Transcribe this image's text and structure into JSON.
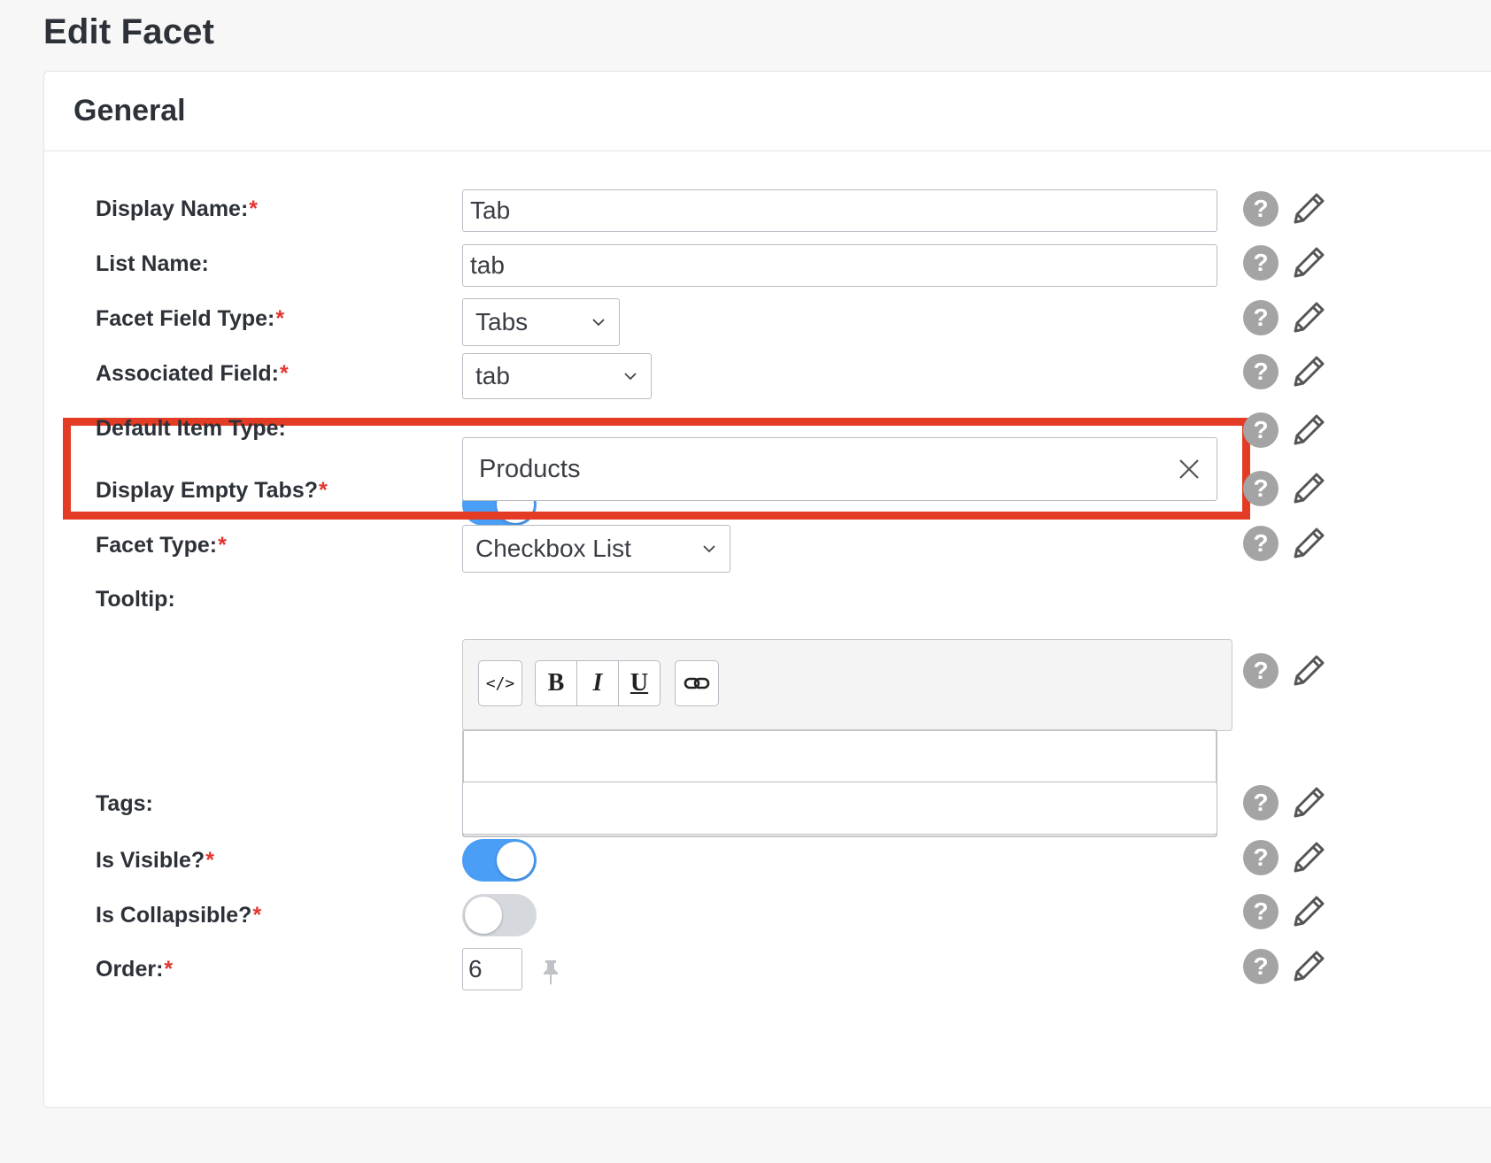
{
  "page": {
    "title": "Edit Facet"
  },
  "section": {
    "title": "General"
  },
  "required_mark": "*",
  "help_symbol": "?",
  "fields": {
    "display_name": {
      "label": "Display Name:",
      "value": "Tab",
      "required": true
    },
    "list_name": {
      "label": "List Name:",
      "value": "tab",
      "required": false
    },
    "facet_field_type": {
      "label": "Facet Field Type:",
      "value": "Tabs",
      "required": true
    },
    "associated_field": {
      "label": "Associated Field:",
      "value": "tab",
      "required": true
    },
    "default_item_type": {
      "label": "Default Item Type:",
      "value": "Products",
      "required": false
    },
    "display_empty_tabs": {
      "label": "Display Empty Tabs?",
      "checked": true,
      "required": true
    },
    "facet_type": {
      "label": "Facet Type:",
      "value": "Checkbox List",
      "required": true
    },
    "tooltip": {
      "label": "Tooltip:",
      "value": "",
      "required": false
    },
    "tags": {
      "label": "Tags:",
      "value": "",
      "required": false
    },
    "is_visible": {
      "label": "Is Visible?",
      "checked": true,
      "required": true
    },
    "is_collapsible": {
      "label": "Is Collapsible?",
      "checked": false,
      "required": true
    },
    "order": {
      "label": "Order:",
      "value": "6",
      "required": true
    }
  },
  "editor_toolbar": {
    "code": "</>",
    "bold": "B",
    "italic": "I",
    "underline": "U"
  },
  "colors": {
    "accent": "#4a9ef5",
    "required": "#e3342f",
    "highlight": "#e43b24",
    "help": "#a4a4a4"
  }
}
